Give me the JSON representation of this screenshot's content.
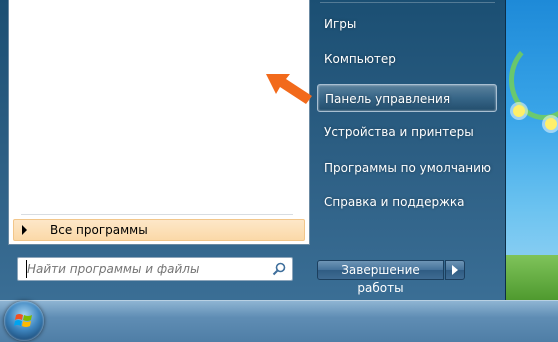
{
  "start_menu": {
    "right_items": [
      {
        "label": "Игры"
      },
      {
        "label": "Компьютер"
      },
      {
        "label": "Панель управления"
      },
      {
        "label": "Устройства и принтеры"
      },
      {
        "label": "Программы по умолчанию"
      },
      {
        "label": "Справка и поддержка"
      }
    ],
    "all_programs_label": "Все программы",
    "search": {
      "placeholder": "Найти программы и файлы"
    },
    "shutdown_label": "Завершение работы"
  },
  "colors": {
    "highlight_arrow": "#f26a1b",
    "all_programs_bg": "#fbd9a8"
  },
  "icons": {
    "search": "search-icon",
    "start": "windows-start-orb-icon",
    "pointer": "orange-arrow-icon"
  }
}
